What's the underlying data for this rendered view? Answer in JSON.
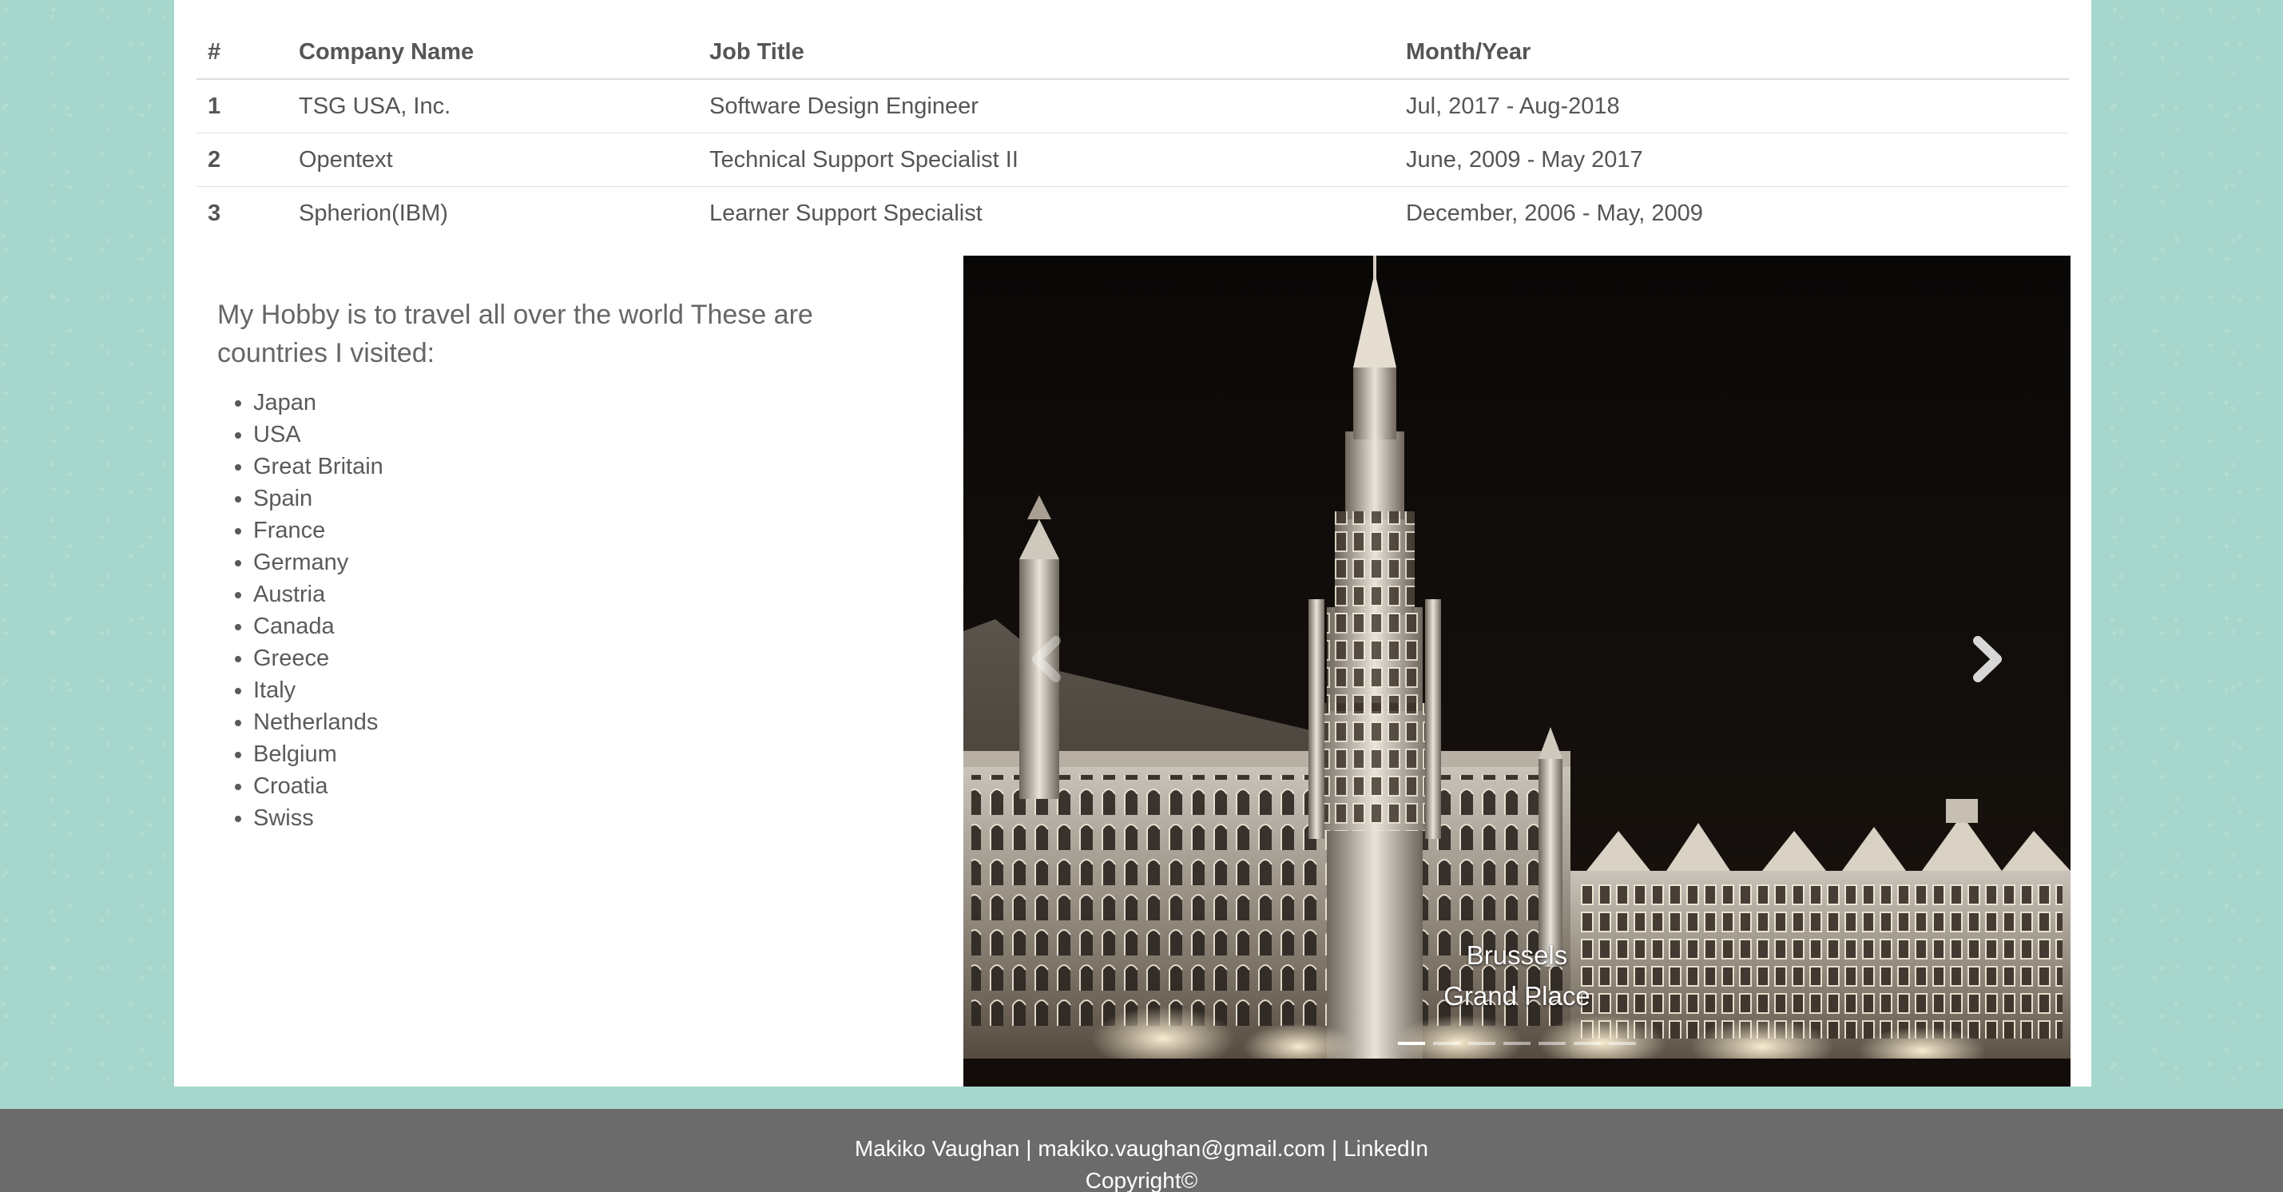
{
  "experience_table": {
    "headers": [
      "#",
      "Company Name",
      "Job Title",
      "Month/Year"
    ],
    "rows": [
      {
        "num": "1",
        "company": "TSG USA, Inc.",
        "title": "Software Design Engineer",
        "period": "Jul, 2017 - Aug-2018"
      },
      {
        "num": "2",
        "company": "Opentext",
        "title": "Technical Support Specialist II",
        "period": "June, 2009 - May 2017"
      },
      {
        "num": "3",
        "company": "Spherion(IBM)",
        "title": "Learner Support Specialist",
        "period": "December, 2006 - May, 2009"
      }
    ]
  },
  "hobby": {
    "intro": "My Hobby is to travel all over the world These are countries I visited:",
    "countries": [
      "Japan",
      "USA",
      "Great Britain",
      "Spain",
      "France",
      "Germany",
      "Austria",
      "Canada",
      "Greece",
      "Italy",
      "Netherlands",
      "Belgium",
      "Croatia",
      "Swiss"
    ]
  },
  "carousel": {
    "caption_city": "Brussels",
    "caption_place": "Grand Place",
    "prev_icon": "chevron-left-icon",
    "next_icon": "chevron-right-icon",
    "active_slide": 0,
    "slide_count": 7
  },
  "footer": {
    "name": "Makiko Vaughan",
    "separator": "|",
    "email": "makiko.vaughan@gmail.com",
    "linkedin": "LinkedIn",
    "copyright": "Copyright©"
  },
  "colors": {
    "background": "#a7d6cc",
    "footer": "#6b6b6b",
    "text": "#5a5a5a"
  }
}
